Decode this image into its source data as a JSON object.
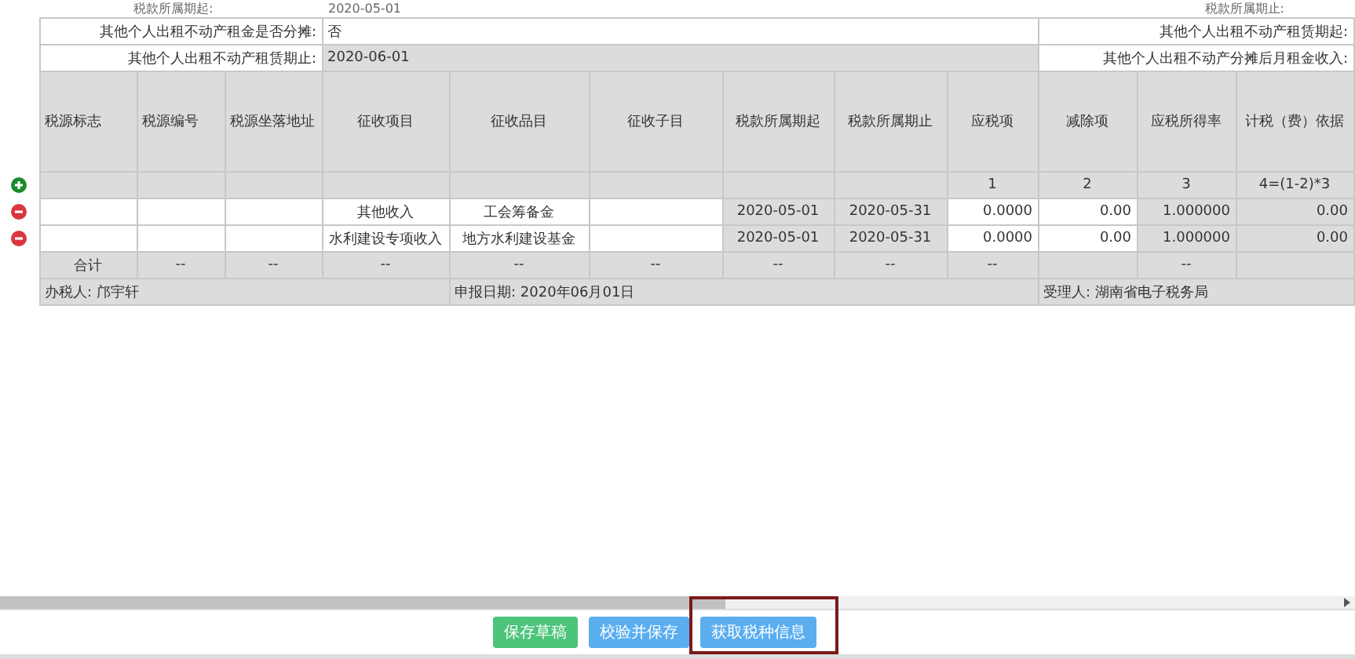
{
  "period": {
    "start_label": "税款所属期起:",
    "start_value": "2020-05-01",
    "end_label": "税款所属期止:"
  },
  "info_rows": [
    {
      "label": "其他个人出租不动产租金是否分摊:",
      "value": "否",
      "value_disabled": false,
      "right_label": "其他个人出租不动产租赁期起:"
    },
    {
      "label": "其他个人出租不动产租赁期止:",
      "value": "2020-06-01",
      "value_disabled": true,
      "right_label": "其他个人出租不动产分摊后月租金收入:"
    }
  ],
  "table": {
    "columns": [
      "税源标志",
      "税源编号",
      "税源坐落地址",
      "征收项目",
      "征收品目",
      "征收子目",
      "税款所属期起",
      "税款所属期止",
      "应税项",
      "减除项",
      "应税所得率",
      "计税（费）依据"
    ],
    "index_row": [
      "1",
      "2",
      "3",
      "4=(1-2)*3"
    ],
    "rows": [
      {
        "cells": [
          "",
          "",
          "",
          "其他收入",
          "工会筹备金",
          "",
          "2020-05-01",
          "2020-05-31",
          "0.0000",
          "0.00",
          "1.000000",
          "0.00"
        ]
      },
      {
        "cells": [
          "",
          "",
          "",
          "水利建设专项收入",
          "地方水利建设基金",
          "",
          "2020-05-01",
          "2020-05-31",
          "0.0000",
          "0.00",
          "1.000000",
          "0.00"
        ]
      }
    ],
    "total_row": [
      {
        "kind": "text",
        "text": "合计"
      },
      {
        "kind": "text",
        "text": "--"
      },
      {
        "kind": "text",
        "text": "--"
      },
      {
        "kind": "text",
        "text": "--"
      },
      {
        "kind": "text",
        "text": "--"
      },
      {
        "kind": "text",
        "text": "--"
      },
      {
        "kind": "text",
        "text": "--"
      },
      {
        "kind": "text",
        "text": "--"
      },
      {
        "kind": "text",
        "text": "--"
      },
      {
        "kind": "empty"
      },
      {
        "kind": "text",
        "text": "--"
      },
      {
        "kind": "empty"
      }
    ],
    "footer": [
      "办税人: 邝宇轩",
      "申报日期: 2020年06月01日",
      "受理人: 湖南省电子税务局"
    ]
  },
  "buttons": [
    {
      "label": "保存草稿",
      "kind": "success",
      "highlighted": false
    },
    {
      "label": "校验并保存",
      "kind": "primary",
      "highlighted": false
    },
    {
      "label": "获取税种信息",
      "kind": "primary",
      "highlighted": true
    }
  ]
}
